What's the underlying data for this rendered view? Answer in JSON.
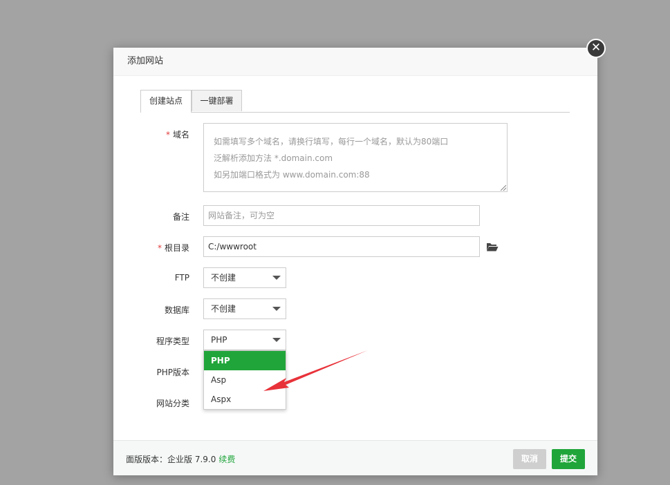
{
  "dialog": {
    "title": "添加网站",
    "close_icon": "close-icon"
  },
  "tabs": [
    {
      "label": "创建站点",
      "active": true
    },
    {
      "label": "一键部署",
      "active": false
    }
  ],
  "form": {
    "domain": {
      "label": "域名",
      "required": "*",
      "placeholder_lines": [
        "如需填写多个域名，请换行填写，每行一个域名，默认为80端口",
        "泛解析添加方法 *.domain.com",
        "如另加端口格式为 www.domain.com:88"
      ]
    },
    "remark": {
      "label": "备注",
      "placeholder": "网站备注，可为空"
    },
    "root_dir": {
      "label": "根目录",
      "required": "*",
      "value": "C:/wwwroot",
      "icon": "folder-open-icon"
    },
    "ftp": {
      "label": "FTP",
      "value": "不创建"
    },
    "database": {
      "label": "数据库",
      "value": "不创建"
    },
    "program_type": {
      "label": "程序类型",
      "value": "PHP",
      "options": [
        "PHP",
        "Asp",
        "Aspx"
      ],
      "highlighted": "PHP"
    },
    "php_version": {
      "label": "PHP版本"
    },
    "site_category": {
      "label": "网站分类"
    }
  },
  "footer": {
    "version_text": "面版版本：企业版 7.9.0",
    "renew_link": "续费",
    "cancel_label": "取消",
    "submit_label": "提交"
  },
  "colors": {
    "accent": "#20a53a",
    "required": "#e23c3c",
    "annotation_arrow": "#e8323a"
  }
}
